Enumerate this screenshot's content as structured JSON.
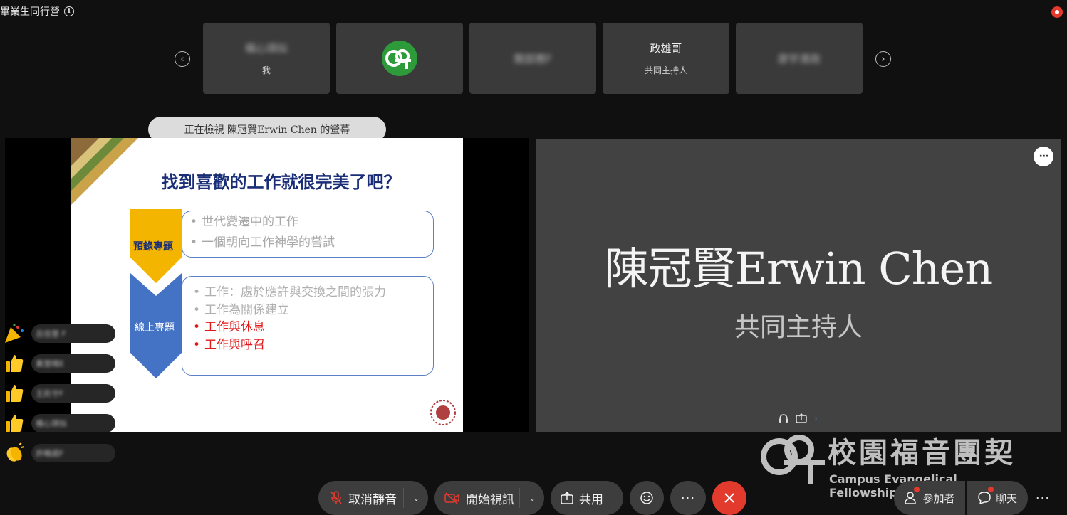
{
  "meeting": {
    "title": "畢業生同行營"
  },
  "colors": {
    "accent_red": "#e23b2e",
    "slide_title": "#1a2e78",
    "emphasis_red": "#e01a1a",
    "chevron_gold": "#f3b500",
    "chevron_blue": "#4472c4",
    "cef_green": "#2e9b3a"
  },
  "participants": [
    {
      "name": "楊心琪似",
      "sub": "我",
      "blurred": true,
      "avatar": ""
    },
    {
      "name": "",
      "sub": "",
      "blurred": false,
      "avatar": "cef-logo-icon"
    },
    {
      "name": "簡部應F",
      "sub": "",
      "blurred": true,
      "avatar": ""
    },
    {
      "name": "政雄哥",
      "sub": "共同主持人",
      "blurred": false,
      "avatar": ""
    },
    {
      "name": "廖宇清政",
      "sub": "",
      "blurred": true,
      "avatar": ""
    }
  ],
  "share": {
    "viewing_text": "正在檢視 陳冠賢Erwin Chen 的螢幕",
    "slide": {
      "title": "找到喜歡的工作就很完美了吧？",
      "pre_label": "預錄專題",
      "pre_items": [
        "世代變遷中的工作",
        "一個朝向工作神學的嘗試"
      ],
      "live_label": "線上專題",
      "live_items": [
        {
          "text": "工作：處於應許與交換之間的張力",
          "emphasis": false
        },
        {
          "text": "工作為關係建立",
          "emphasis": false
        },
        {
          "text": "工作與休息",
          "emphasis": true
        },
        {
          "text": "工作與呼召",
          "emphasis": true
        }
      ]
    }
  },
  "reactions": [
    {
      "emoji": "party-popper-icon",
      "name": "呂佳慧 F"
    },
    {
      "emoji": "thumbs-up-icon",
      "name": "黃慧晴E"
    },
    {
      "emoji": "thumbs-up-icon",
      "name": "王民守F"
    },
    {
      "emoji": "thumbs-up-icon",
      "name": "楊心琪似"
    },
    {
      "emoji": "clapping-hands-icon",
      "name": "許曉諾F"
    }
  ],
  "speaker": {
    "name": "陳冠賢Erwin Chen",
    "role": "共同主持人"
  },
  "watermark": {
    "zh": "校園福音團契",
    "en": "Campus Evangelical Fellowship"
  },
  "controls": {
    "mute_label": "取消靜音",
    "video_label": "開始視訊",
    "share_label": "共用",
    "participants_label": "參加者",
    "chat_label": "聊天"
  }
}
